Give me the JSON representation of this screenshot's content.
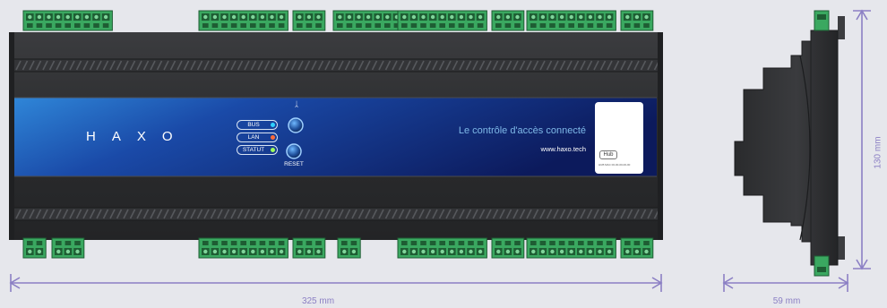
{
  "colors": {
    "background": "#e6e7ec",
    "housing": "#2d2e30",
    "housing_light": "#3a3b3d",
    "panel_blue_start": "#2f7fd3",
    "panel_blue_end": "#0d1f63",
    "terminal_green": "#3aa860",
    "terminal_dark": "#1e5d33",
    "dimension": "#8b7fc4"
  },
  "front": {
    "brand": "HAXO",
    "tagline": "Le contrôle d'accès connecté",
    "website": "www.haxo.tech",
    "leds": [
      {
        "label": "BUS",
        "color": "#2fd0ff"
      },
      {
        "label": "LAN",
        "color": "#ff6b3a"
      },
      {
        "label": "STATUT",
        "color": "#9cff5a"
      }
    ],
    "bluetooth_icon": "bluetooth-icon",
    "reset_label": "RESET",
    "hub_badge": "Hub",
    "qr_fine_print": "HUB  MAC 00-00-00-00-00"
  },
  "terminals": {
    "top": [
      {
        "pins": 9
      },
      {
        "pins": 9
      },
      {
        "pins": 3
      },
      {
        "pins": 9
      },
      {
        "pins": 9
      },
      {
        "pins": 3
      },
      {
        "pins": 9
      },
      {
        "pins": 3
      }
    ],
    "bottom": [
      {
        "pins": 2
      },
      {
        "pins": 3
      },
      {
        "pins": 9
      },
      {
        "pins": 3
      },
      {
        "pins": 2
      },
      {
        "pins": 9
      },
      {
        "pins": 3
      },
      {
        "pins": 9
      },
      {
        "pins": 3
      }
    ]
  },
  "dimensions": {
    "width": "325 mm",
    "depth": "59 mm",
    "height": "130 mm"
  }
}
